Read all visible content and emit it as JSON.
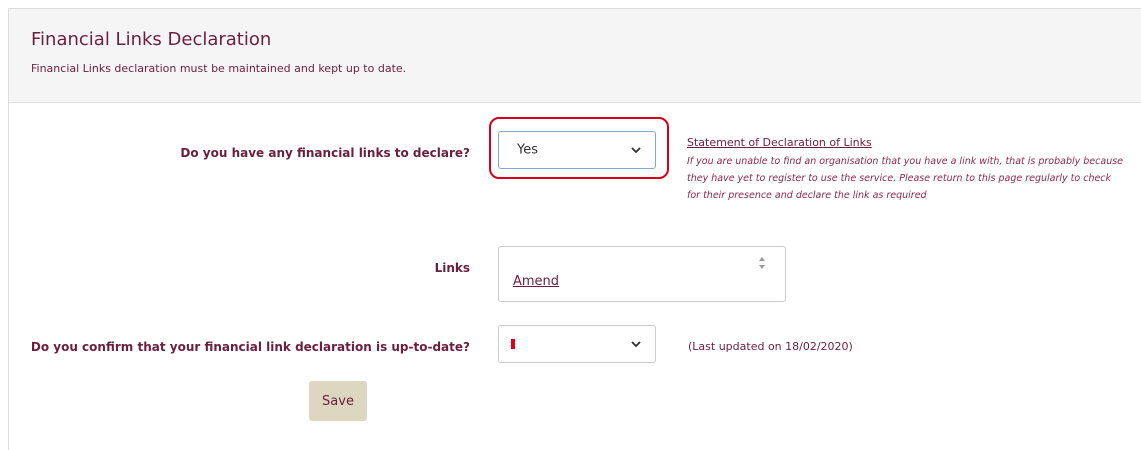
{
  "header": {
    "title": "Financial Links Declaration",
    "subtitle": "Financial Links declaration must be maintained and kept up to date."
  },
  "financial_links": {
    "question": "Do you have any financial links to declare?",
    "selected_value": "Yes",
    "statement_link": "Statement of Declaration of Links",
    "statement_note": "If you are unable to find an organisation that you have a link with, that is probably because they have yet to register to use the service. Please return to this page regularly to check for their presence and declare the link as required"
  },
  "links": {
    "label": "Links",
    "amend_label": "Amend"
  },
  "confirmation": {
    "question": "Do you confirm that your financial link declaration is up-to-date?",
    "selected_value": "",
    "last_updated": "(Last updated on 18/02/2020)"
  },
  "actions": {
    "save_label": "Save"
  },
  "colors": {
    "accent": "#6b1f3d",
    "highlight": "#d6001c",
    "button_bg": "#ddd6c1",
    "header_bg": "#f5f5f5"
  }
}
